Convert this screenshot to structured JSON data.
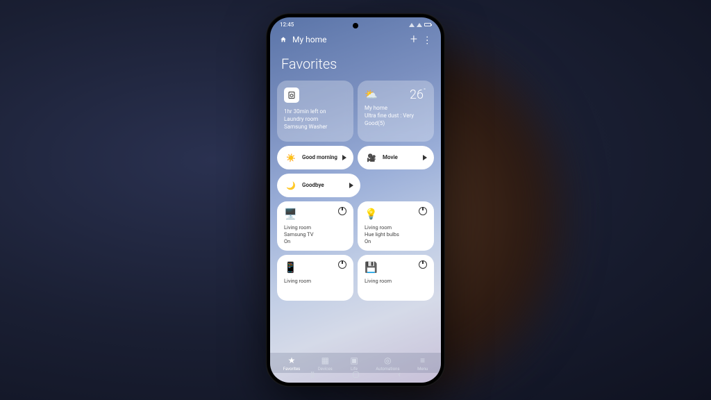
{
  "statusbar": {
    "time": "12:45"
  },
  "header": {
    "title": "My home"
  },
  "page_title": "Favorites",
  "info_cards": {
    "washer": {
      "line1": "1hr 30min left on",
      "line2": "Laundry room",
      "line3": "Samsung Washer"
    },
    "weather": {
      "temp": "26",
      "line1": "My home",
      "line2": "Ultra fine dust : Very Good(5)"
    }
  },
  "scenes": [
    {
      "label": "Good morning"
    },
    {
      "label": "Movie"
    },
    {
      "label": "Goodbye"
    }
  ],
  "devices": [
    {
      "room": "Living room",
      "name": "Samsung TV",
      "state": "On"
    },
    {
      "room": "Living room",
      "name": "Hue light bulbs",
      "state": "On"
    },
    {
      "room": "Living room",
      "name": "",
      "state": ""
    },
    {
      "room": "Living room",
      "name": "",
      "state": ""
    }
  ],
  "nav": {
    "favorites": "Favorites",
    "devices": "Devices",
    "life": "Life",
    "automations": "Automations",
    "menu": "Menu"
  }
}
